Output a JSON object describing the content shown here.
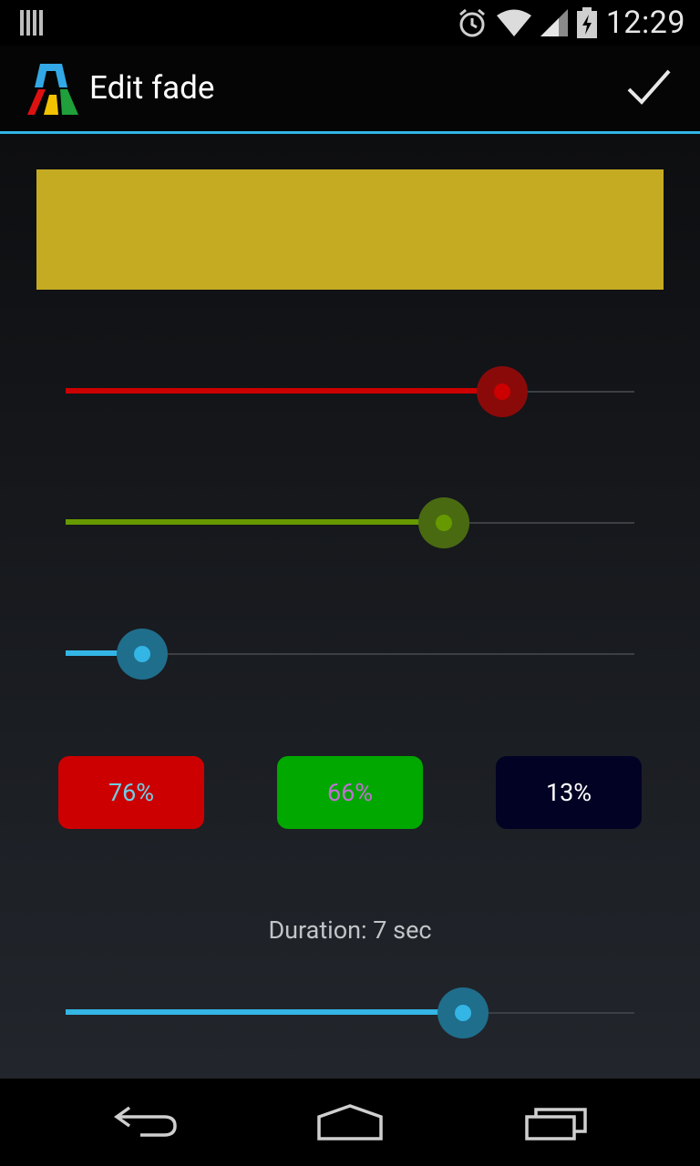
{
  "status_bar": {
    "time": "12:29",
    "icons": [
      "notification-bars-icon",
      "alarm-icon",
      "wifi-icon",
      "cell-signal-icon",
      "battery-charging-icon"
    ]
  },
  "action_bar": {
    "title": "Edit fade",
    "app_icon": "app-logo-icon",
    "done_icon": "checkmark-icon"
  },
  "preview": {
    "color": "#c5ab22"
  },
  "sliders": {
    "red": {
      "value": 0.767,
      "color": "#cc0000",
      "halo": "#8a0a0a"
    },
    "green": {
      "value": 0.665,
      "color": "#669900",
      "halo": "#4a6a12"
    },
    "blue": {
      "value": 0.135,
      "color": "#33b5e5",
      "halo": "#1f6e8c"
    }
  },
  "chips": [
    {
      "label": "76%",
      "bg": "#cc0000",
      "fg": "#6fcfe8"
    },
    {
      "label": "66%",
      "bg": "#00a800",
      "fg": "#c46fd6"
    },
    {
      "label": "13%",
      "bg": "#020224",
      "fg": "#ffffff"
    }
  ],
  "duration": {
    "label": "Duration: 7 sec",
    "value": 0.699,
    "color": "#33b5e5",
    "halo": "#1f6e8c"
  },
  "nav_bar": {
    "icons": [
      "back-icon",
      "home-icon",
      "recent-apps-icon"
    ]
  }
}
